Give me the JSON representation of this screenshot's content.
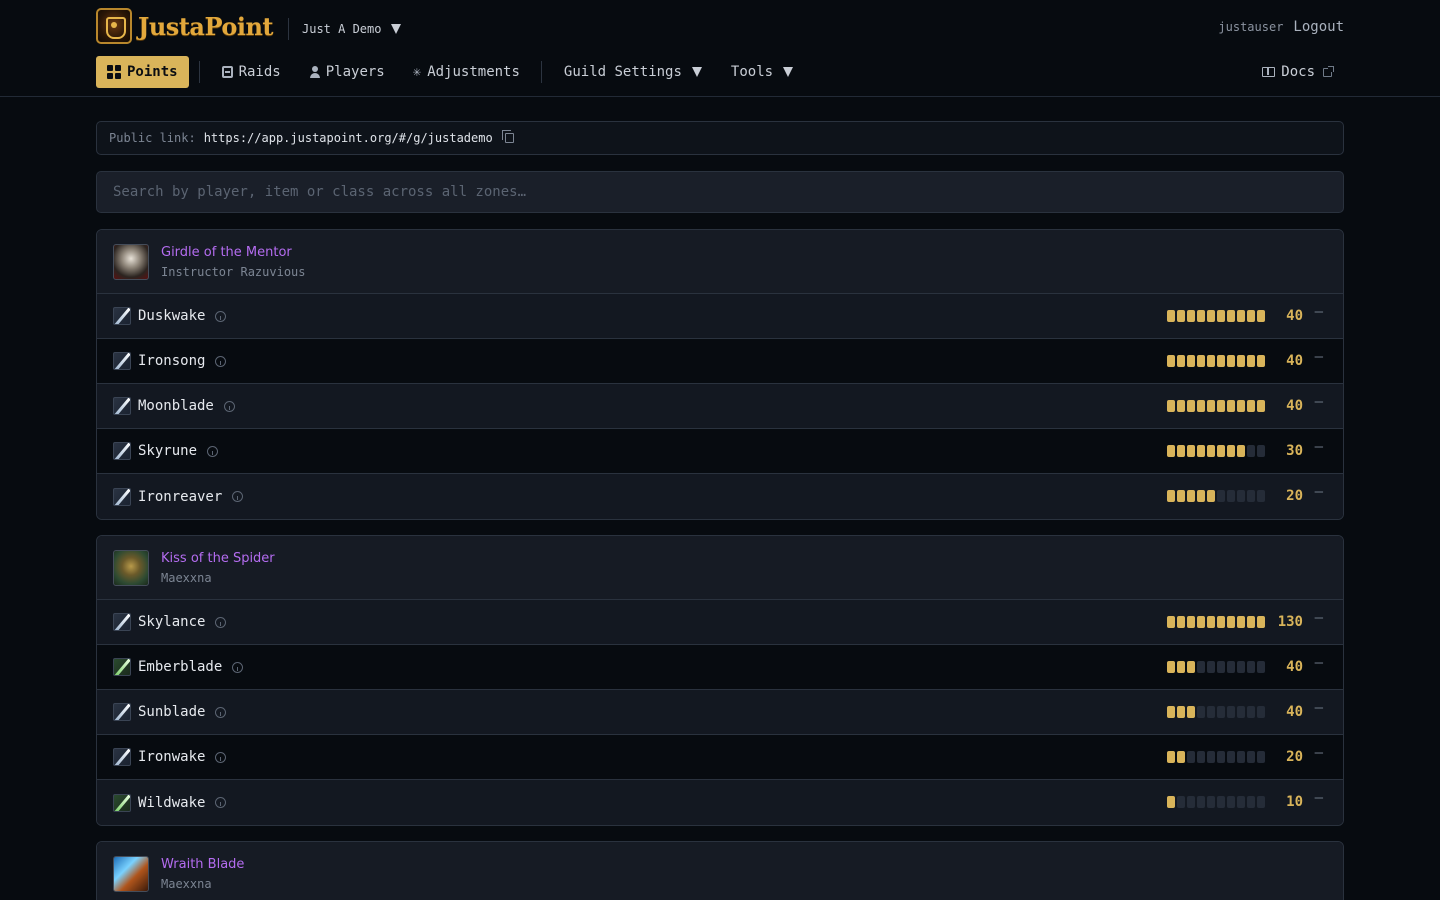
{
  "brand": {
    "name": "JustaPoint",
    "logo_icon": "justapoint-logo-icon"
  },
  "guild_select": {
    "label": "Just A Demo"
  },
  "user": {
    "name": "justauser",
    "logout_label": "Logout"
  },
  "nav": {
    "points": "Points",
    "raids": "Raids",
    "players": "Players",
    "adjustments": "Adjustments",
    "guild_settings": "Guild Settings",
    "tools": "Tools",
    "docs": "Docs"
  },
  "public_link": {
    "label": "Public link:",
    "url": "https://app.justapoint.org/#/g/justademo"
  },
  "search": {
    "placeholder": "Search by player, item or class across all zones…"
  },
  "colors": {
    "accent": "#d9b45a",
    "item_epic": "#b46cf0",
    "background": "#070b10"
  },
  "items": [
    {
      "name": "Girdle of the Mentor",
      "boss": "Instructor Razuvious",
      "icon": "girdle-of-the-mentor-icon",
      "players": [
        {
          "name": "Duskwake",
          "class_icon": "warrior-icon",
          "points": "40",
          "level": 10,
          "max": 10
        },
        {
          "name": "Ironsong",
          "class_icon": "warrior-icon",
          "points": "40",
          "level": 10,
          "max": 10
        },
        {
          "name": "Moonblade",
          "class_icon": "warrior-icon",
          "points": "40",
          "level": 10,
          "max": 10
        },
        {
          "name": "Skyrune",
          "class_icon": "warrior-icon",
          "points": "30",
          "level": 8,
          "max": 10
        },
        {
          "name": "Ironreaver",
          "class_icon": "warrior-icon",
          "points": "20",
          "level": 5,
          "max": 10
        }
      ]
    },
    {
      "name": "Kiss of the Spider",
      "boss": "Maexxna",
      "icon": "kiss-of-the-spider-icon",
      "players": [
        {
          "name": "Skylance",
          "class_icon": "warrior-icon",
          "points": "130",
          "level": 10,
          "max": 10
        },
        {
          "name": "Emberblade",
          "class_icon": "hunter-icon",
          "points": "40",
          "level": 3,
          "max": 10
        },
        {
          "name": "Sunblade",
          "class_icon": "warrior-icon",
          "points": "40",
          "level": 3,
          "max": 10
        },
        {
          "name": "Ironwake",
          "class_icon": "warrior-icon",
          "points": "20",
          "level": 2,
          "max": 10
        },
        {
          "name": "Wildwake",
          "class_icon": "hunter-icon",
          "points": "10",
          "level": 1,
          "max": 10
        }
      ]
    },
    {
      "name": "Wraith Blade",
      "boss": "Maexxna",
      "icon": "wraith-blade-icon",
      "players": []
    }
  ]
}
